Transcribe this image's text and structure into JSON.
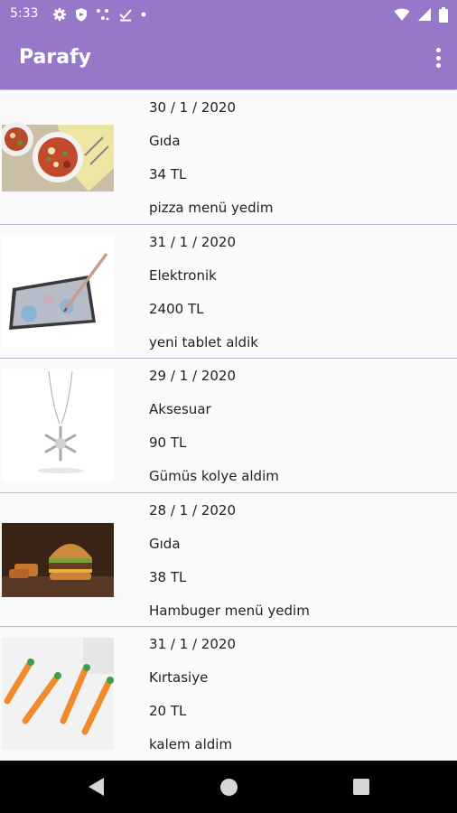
{
  "status_bar": {
    "time": "5:33",
    "icons": [
      "gear-icon",
      "shield-icon",
      "nodes-icon",
      "download-done-icon",
      "dot-icon",
      "wifi-icon",
      "signal-icon",
      "battery-icon"
    ]
  },
  "app_bar": {
    "title": "Parafy",
    "menu_icon": "more-vert-icon"
  },
  "expenses": [
    {
      "date": "30 / 1 / 2020",
      "category": "Gıda",
      "amount": "34 TL",
      "note": "pizza menü yedim",
      "image": "pizza"
    },
    {
      "date": "31 / 1 / 2020",
      "category": "Elektronik",
      "amount": "2400 TL",
      "note": "yeni tablet aldik",
      "image": "tablet"
    },
    {
      "date": "29 / 1 / 2020",
      "category": "Aksesuar",
      "amount": "90 TL",
      "note": "Gümüs kolye aldim",
      "image": "necklace"
    },
    {
      "date": "28 / 1 / 2020",
      "category": "Gıda",
      "amount": "38 TL",
      "note": "Hambuger menü yedim",
      "image": "hamburger"
    },
    {
      "date": "31 / 1 / 2020",
      "category": "Kırtasiye",
      "amount": "20 TL",
      "note": "kalem aldim",
      "image": "carrot-pens"
    }
  ],
  "nav_bar": {
    "buttons": [
      "back-icon",
      "home-icon",
      "recents-icon"
    ]
  },
  "colors": {
    "app_bar": "#9678c9",
    "divider": "#b9b3d9",
    "background": "#fafafa"
  }
}
